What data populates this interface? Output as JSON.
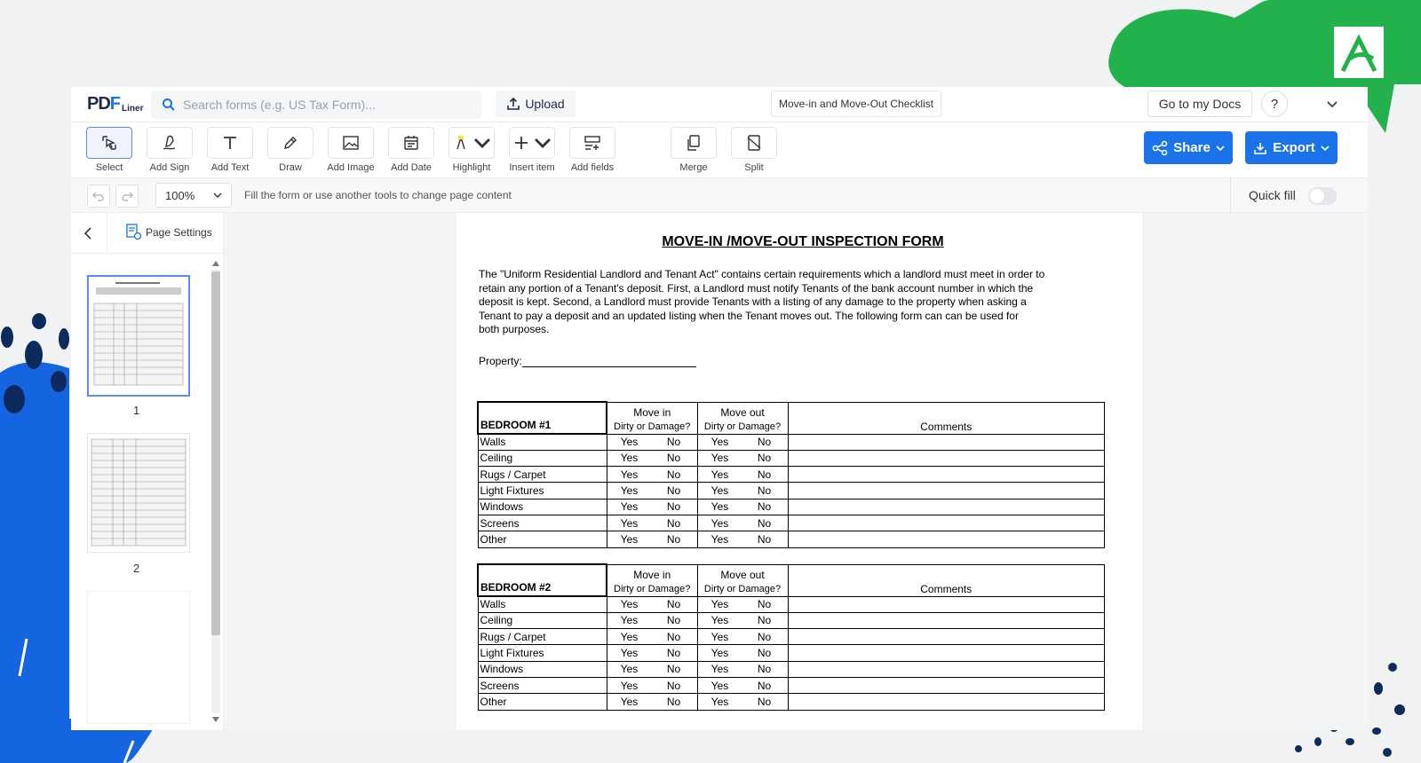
{
  "header": {
    "logo_main": "PDF",
    "logo_sub": "Liner",
    "search_placeholder": "Search forms (e.g. US Tax Form)...",
    "upload_label": "Upload",
    "doc_title": "Move-in and Move-Out Checklist",
    "my_docs_label": "Go to my Docs",
    "help_label": "?"
  },
  "toolbar": {
    "tools": [
      {
        "label": "Select",
        "icon": "select-cursor-icon"
      },
      {
        "label": "Add Sign",
        "icon": "sign-pen-icon"
      },
      {
        "label": "Add Text",
        "icon": "text-icon"
      },
      {
        "label": "Draw",
        "icon": "pen-icon"
      },
      {
        "label": "Add Image",
        "icon": "image-icon"
      },
      {
        "label": "Add Date",
        "icon": "calendar-icon"
      },
      {
        "label": "Highlight",
        "icon": "highlighter-icon"
      },
      {
        "label": "Insert item",
        "icon": "plus-icon"
      },
      {
        "label": "Add fields",
        "icon": "fields-icon"
      },
      {
        "label": "Merge",
        "icon": "merge-icon"
      },
      {
        "label": "Split",
        "icon": "split-icon"
      }
    ],
    "share_label": "Share",
    "export_label": "Export",
    "accent_color": "#1a73e8"
  },
  "subbar": {
    "zoom": "100%",
    "hint": "Fill the form or use another tools to change page content",
    "quick_fill_label": "Quick fill"
  },
  "sidebar": {
    "page_settings_label": "Page Settings",
    "pages": [
      "1",
      "2"
    ]
  },
  "document": {
    "title": "MOVE-IN /MOVE-OUT INSPECTION FORM",
    "intro_lines": [
      "The \"Uniform Residential Landlord and Tenant Act\" contains certain requirements which a landlord must meet in order to",
      "retain any portion of a Tenant's deposit.  First, a Landlord must notify Tenants of the bank account number in which the",
      "deposit is kept.  Second, a Landlord must provide Tenants with a listing of any damage to the property when asking a",
      "Tenant to pay a deposit and an updated listing when the Tenant moves out.  The following form can can be used for",
      "both purposes."
    ],
    "property_label": "Property:",
    "col_move_in": "Move in",
    "col_move_out": "Move out",
    "col_sub": "Dirty or Damage?",
    "col_comments": "Comments",
    "yes": "Yes",
    "no": "No",
    "rooms": [
      {
        "name": "BEDROOM #1",
        "items": [
          "Walls",
          "Ceiling",
          "Rugs / Carpet",
          "Light Fixtures",
          "Windows",
          "Screens",
          "Other"
        ]
      },
      {
        "name": "BEDROOM #2",
        "items": [
          "Walls",
          "Ceiling",
          "Rugs / Carpet",
          "Light Fixtures",
          "Windows",
          "Screens",
          "Other"
        ]
      }
    ]
  }
}
